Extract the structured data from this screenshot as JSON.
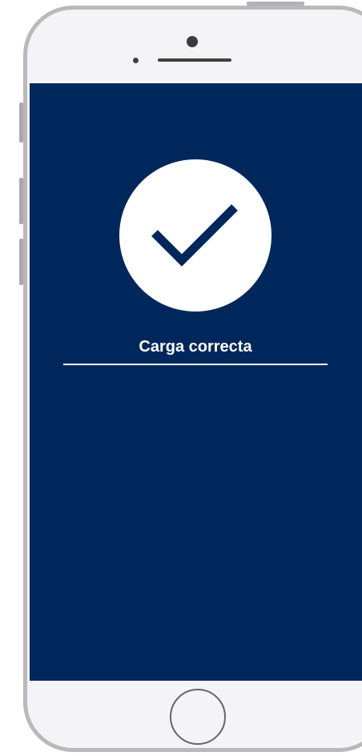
{
  "screen": {
    "status_text": "Carga correcta",
    "icon": "checkmark-icon"
  },
  "colors": {
    "screen_background": "#00275b",
    "check_circle": "#ffffff",
    "checkmark": "#00275b",
    "phone_frame": "#b9b9bb",
    "phone_body": "#f4f4f6"
  }
}
